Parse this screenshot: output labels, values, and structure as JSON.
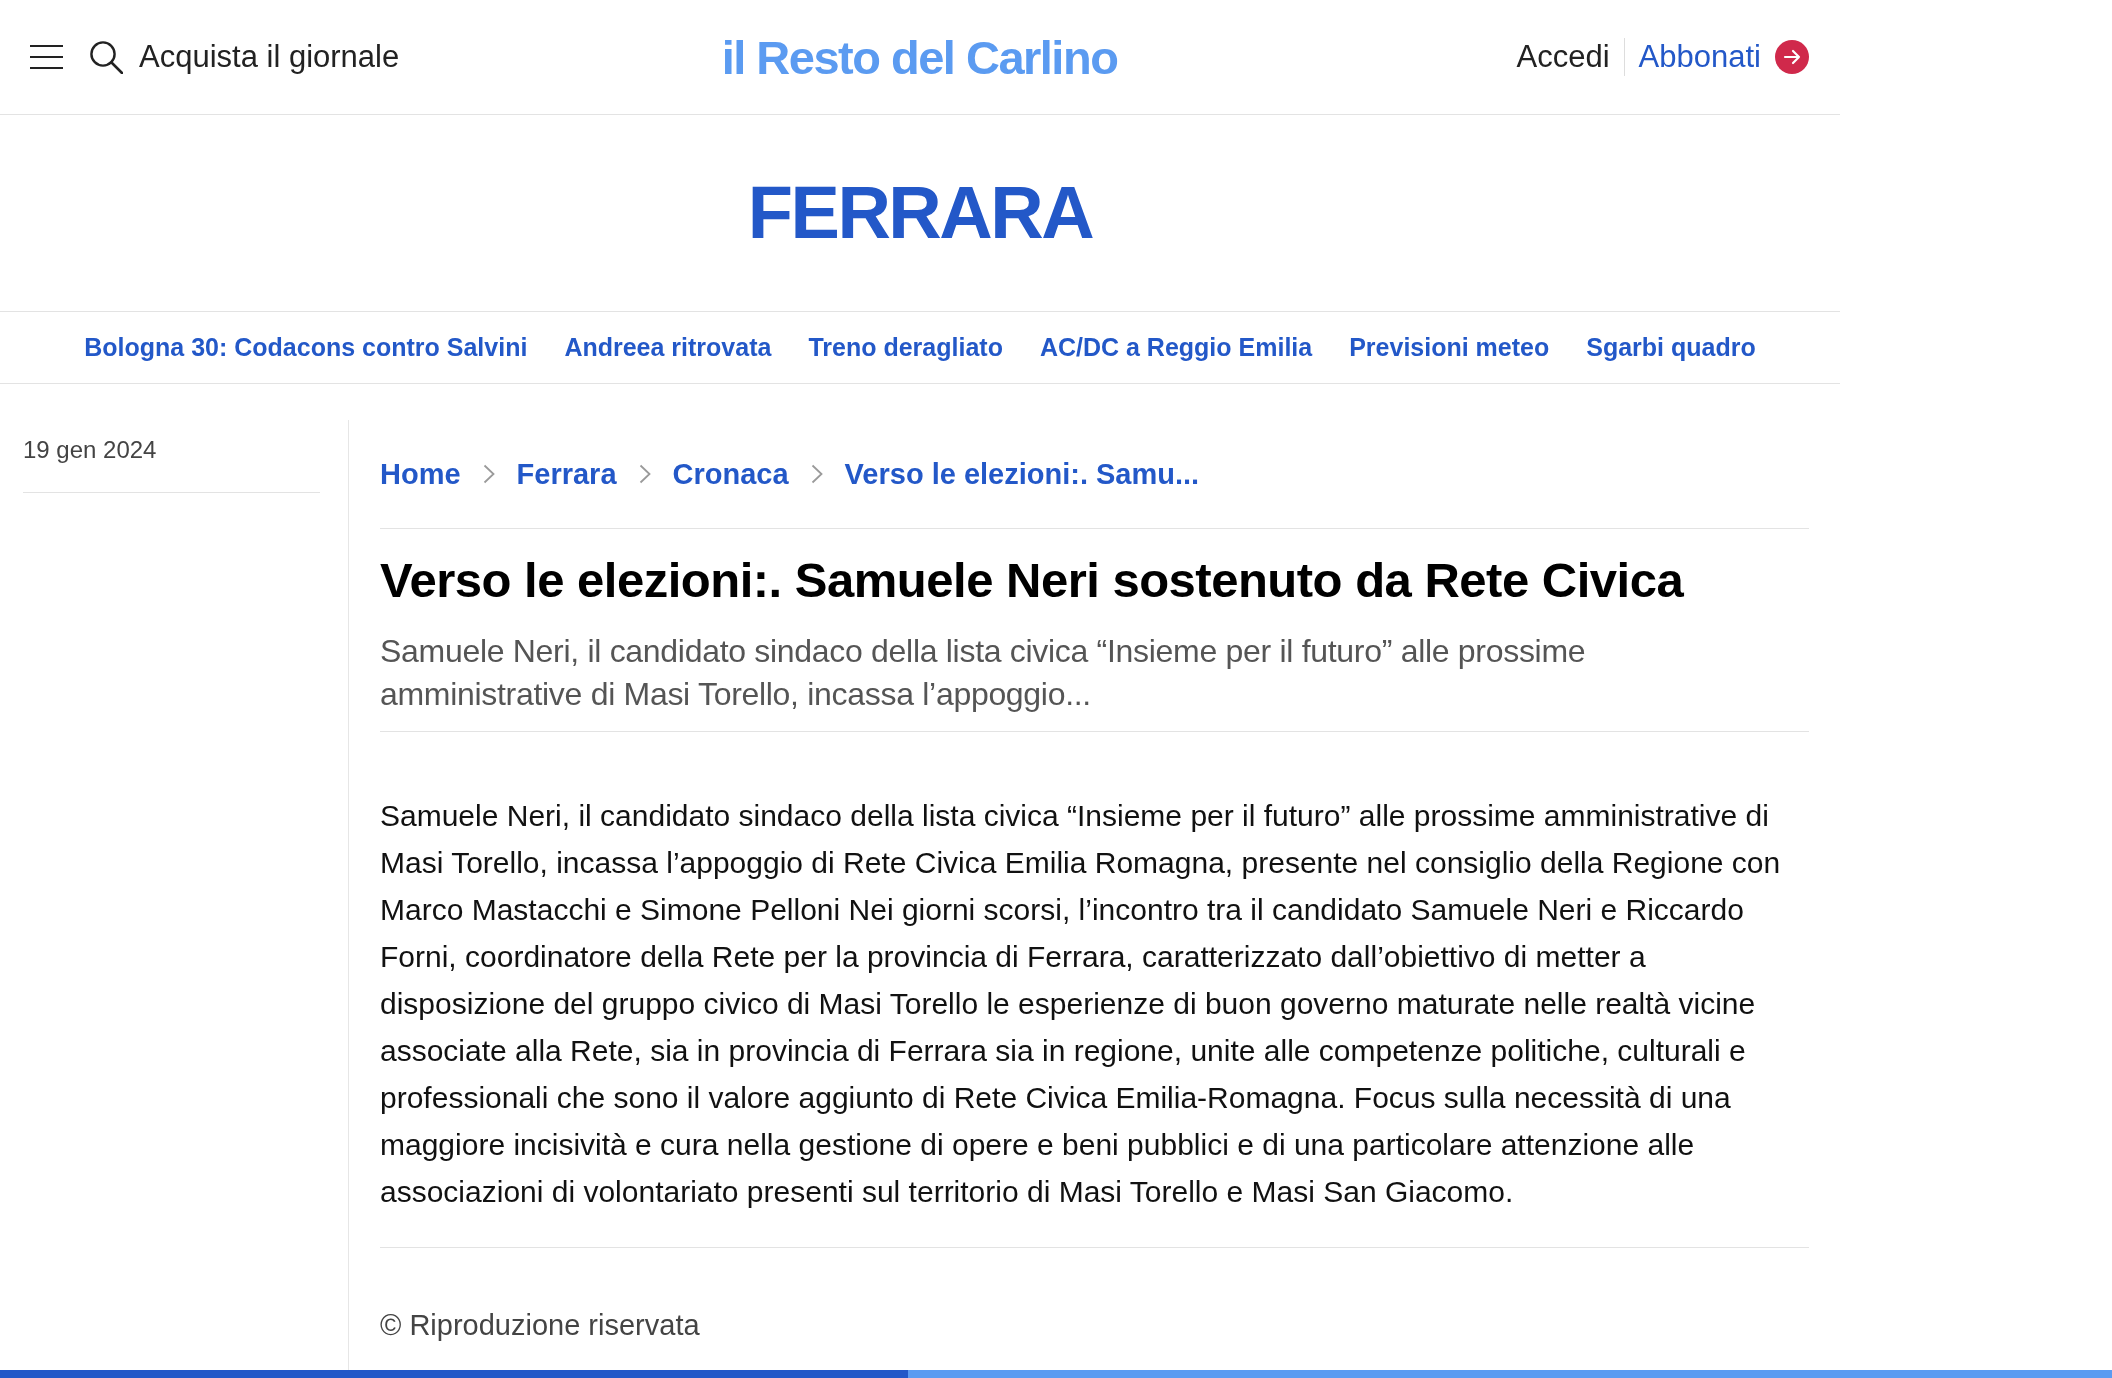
{
  "header": {
    "buy_link": "Acquista il giornale",
    "logo": "il Resto del Carlino",
    "login": "Accedi",
    "subscribe": "Abbonati"
  },
  "section_title": "FERRARA",
  "trending": [
    "Bologna 30: Codacons contro Salvini",
    "Andreea ritrovata",
    "Treno deragliato",
    "AC/DC a Reggio Emilia",
    "Previsioni meteo",
    "Sgarbi quadro"
  ],
  "article": {
    "date": "19 gen 2024",
    "breadcrumb": [
      "Home",
      "Ferrara",
      "Cronaca",
      "Verso le elezioni:. Samu..."
    ],
    "title": "Verso le elezioni:. Samuele Neri sostenuto da Rete Civica",
    "summary": "Samuele Neri, il candidato sindaco della lista civica “Insieme per il futuro” alle prossime amministrative di Masi Torello, incassa l’appoggio...",
    "body": "Samuele Neri, il candidato sindaco della lista civica “Insieme per il futuro” alle prossime amministrative di Masi Torello, incassa l’appoggio di Rete Civica Emilia Romagna, presente nel consiglio della Regione con Marco Mastacchi e Simone Pelloni Nei giorni scorsi, l’incontro tra il candidato Samuele Neri e Riccardo Forni, coordinatore della Rete per la provincia di Ferrara, caratterizzato dall’obiettivo di metter a disposizione del gruppo civico di Masi Torello le esperienze di buon governo maturate nelle realtà vicine associate alla Rete, sia in provincia di Ferrara sia in regione, unite alle competenze politiche, culturali e professionali che sono il valore aggiunto di Rete Civica Emilia-Romagna. Focus sulla necessità di una maggiore incisività e cura nella gestione di opere e beni pubblici e di una particolare attenzione alle associazioni di volontariato presenti sul territorio di Masi Torello e Masi San Giacomo.",
    "copyright": "© Riproduzione riservata"
  },
  "reading_progress": {
    "level": 0.43
  }
}
